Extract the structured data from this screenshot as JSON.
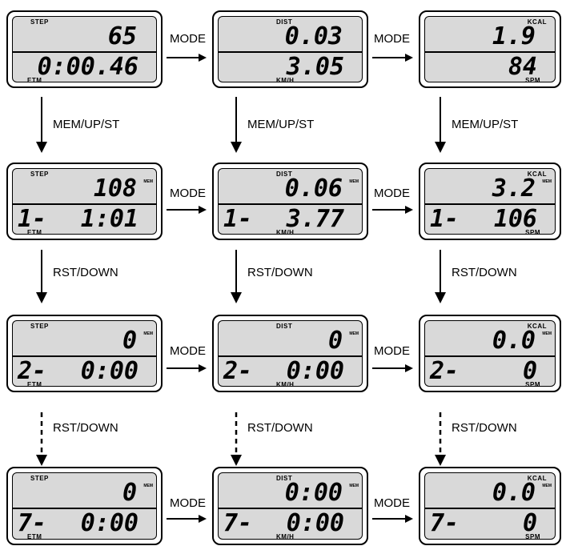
{
  "labels": {
    "step": "STEP",
    "dist": "DIST",
    "kcal": "KCAL",
    "etm": "ETM",
    "kmh": "KM/H",
    "spm": "SPM",
    "mem": "MEM"
  },
  "arrows": {
    "mode": "MODE",
    "mem_up_st": "MEM/UP/ST",
    "rst_down": "RST/DOWN"
  },
  "rows": [
    [
      {
        "top": "65",
        "mem": false,
        "bot_left": "",
        "bot_right": "0:00.46"
      },
      {
        "top": "0.03",
        "mem": false,
        "bot_left": "",
        "bot_right": "3.05"
      },
      {
        "top": "1.9",
        "mem": false,
        "bot_left": "",
        "bot_right": "84"
      }
    ],
    [
      {
        "top": "108",
        "mem": true,
        "bot_left": "1-",
        "bot_right": "1:01"
      },
      {
        "top": "0.06",
        "mem": true,
        "bot_left": "1-",
        "bot_right": "3.77"
      },
      {
        "top": "3.2",
        "mem": true,
        "bot_left": "1-",
        "bot_right": "106"
      }
    ],
    [
      {
        "top": "0",
        "mem": true,
        "bot_left": "2-",
        "bot_right": "0:00"
      },
      {
        "top": "0",
        "mem": true,
        "bot_left": "2-",
        "bot_right": "0:00"
      },
      {
        "top": "0.0",
        "mem": true,
        "bot_left": "2-",
        "bot_right": "0"
      }
    ],
    [
      {
        "top": "0",
        "mem": true,
        "bot_left": "7-",
        "bot_right": "0:00"
      },
      {
        "top": "0:00",
        "mem": true,
        "bot_left": "7-",
        "bot_right": "0:00"
      },
      {
        "top": "0.0",
        "mem": true,
        "bot_left": "7-",
        "bot_right": "0"
      }
    ]
  ]
}
